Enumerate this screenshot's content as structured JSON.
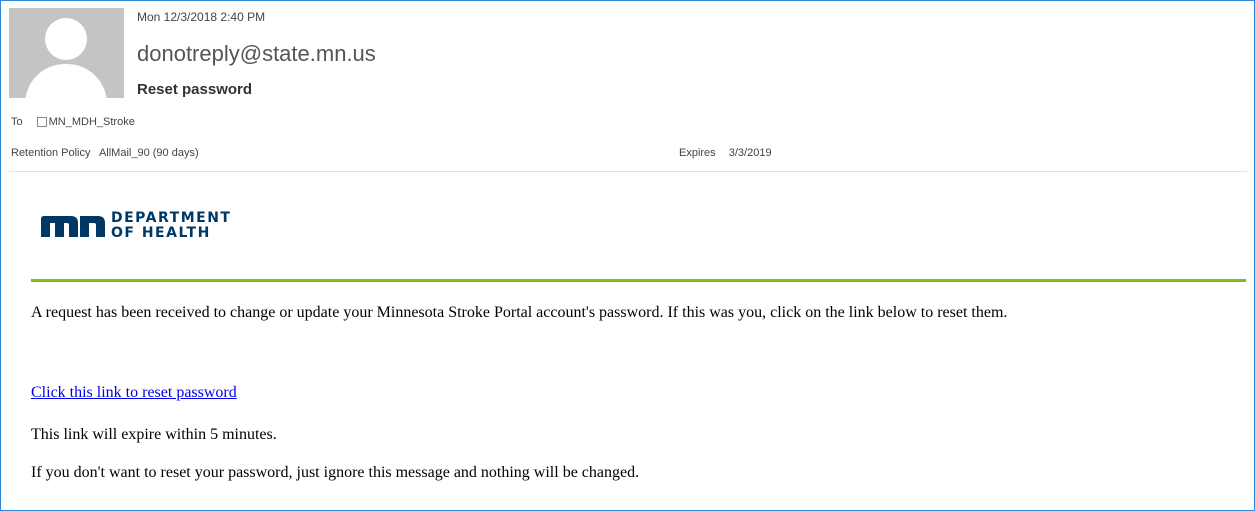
{
  "header": {
    "sent_date": "Mon 12/3/2018 2:40 PM",
    "sender": "donotreply@state.mn.us",
    "subject": "Reset password",
    "to_label": "To",
    "to_recipient": "MN_MDH_Stroke",
    "retention_label": "Retention Policy",
    "retention_value": "AllMail_90 (90 days)",
    "expires_label": "Expires",
    "expires_value": "3/3/2019",
    "avatar_icon": "default-contact-avatar"
  },
  "logo": {
    "icon": "mn-logo-icon",
    "line1": "DEPARTMENT",
    "line2": "OF HEALTH",
    "color": "#003865",
    "rule_color": "#78be20"
  },
  "body": {
    "paragraph1": "A request has been received to change or update your Minnesota Stroke Portal account's password. If this was you, click on the link below to reset them.",
    "reset_link": "Click this link to reset password",
    "paragraph2": "This link will expire within 5 minutes.",
    "paragraph3": "If you don't want to reset your password, just ignore this message and nothing will be changed."
  },
  "colors": {
    "frame_border": "#2b88d8",
    "link": "#0000ee"
  }
}
